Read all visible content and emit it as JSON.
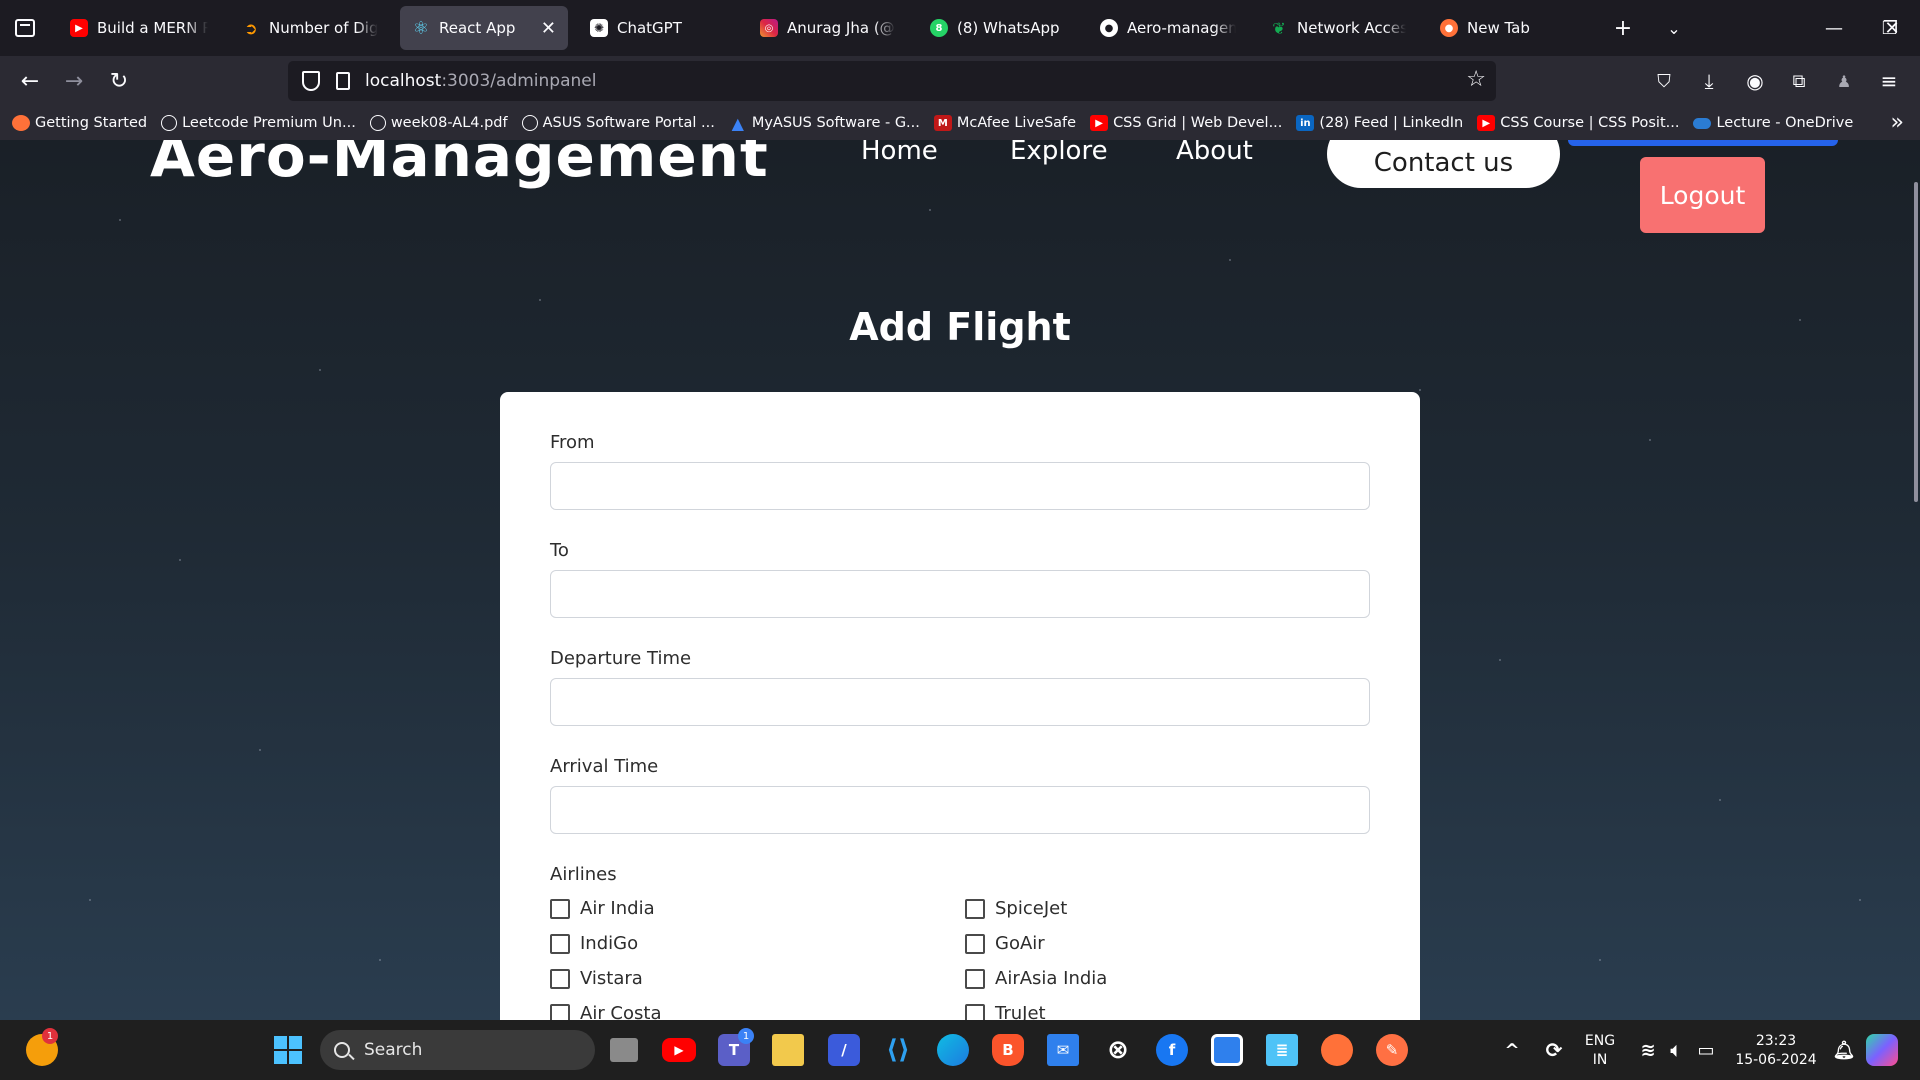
{
  "browser": {
    "tabs": [
      {
        "label": "Build a MERN Rea",
        "favicon": "youtube-icon",
        "color": "#ff0000"
      },
      {
        "label": "Number of Digit",
        "favicon": "amazon-icon",
        "color": "#ff9900"
      },
      {
        "label": "React App",
        "favicon": "react-icon",
        "color": "#61dafb",
        "active": true
      },
      {
        "label": "ChatGPT",
        "favicon": "chatgpt-icon",
        "color": "#ffffff"
      },
      {
        "label": "Anurag Jha (@anu",
        "favicon": "instagram-icon",
        "color": "#e1306c"
      },
      {
        "label": "(8) WhatsApp",
        "favicon": "whatsapp-icon",
        "color": "#25d366"
      },
      {
        "label": "Aero-manageme",
        "favicon": "github-icon",
        "color": "#ffffff"
      },
      {
        "label": "Network Access |",
        "favicon": "mongodb-icon",
        "color": "#13aa52"
      },
      {
        "label": "New Tab",
        "favicon": "firefox-icon",
        "color": "#ff7139"
      }
    ],
    "url_host": "localhost",
    "url_path": ":3003/adminpanel",
    "bookmarks": [
      {
        "label": "Getting Started",
        "icon": "firefox-icon",
        "color": "#ff7139"
      },
      {
        "label": "Leetcode Premium Un...",
        "icon": "globe-icon",
        "color": "#fbfbfe"
      },
      {
        "label": "week08-AL4.pdf",
        "icon": "globe-icon",
        "color": "#fbfbfe"
      },
      {
        "label": "ASUS Software Portal ...",
        "icon": "globe-icon",
        "color": "#fbfbfe"
      },
      {
        "label": "MyASUS Software - G...",
        "icon": "asus-icon",
        "color": "#3b82f6"
      },
      {
        "label": "McAfee LiveSafe",
        "icon": "mcafee-icon",
        "color": "#c01818"
      },
      {
        "label": "CSS Grid | Web Devel...",
        "icon": "youtube-icon",
        "color": "#ff0000"
      },
      {
        "label": "(28) Feed | LinkedIn",
        "icon": "linkedin-icon",
        "color": "#0a66c2"
      },
      {
        "label": "CSS Course | CSS Posit...",
        "icon": "youtube-icon",
        "color": "#ff0000"
      },
      {
        "label": "Lecture - OneDrive",
        "icon": "onedrive-icon",
        "color": "#2b7cd3"
      }
    ]
  },
  "site": {
    "title": "Aero-Management",
    "nav": {
      "home": "Home",
      "explore": "Explore",
      "about": "About",
      "contact": "Contact us"
    },
    "logout": "Logout"
  },
  "form": {
    "heading": "Add Flight",
    "fields": [
      {
        "label": "From",
        "value": ""
      },
      {
        "label": "To",
        "value": ""
      },
      {
        "label": "Departure Time",
        "value": ""
      },
      {
        "label": "Arrival Time",
        "value": ""
      }
    ],
    "airlines_label": "Airlines",
    "airlines": [
      {
        "name": "Air India",
        "checked": false
      },
      {
        "name": "SpiceJet",
        "checked": false
      },
      {
        "name": "IndiGo",
        "checked": false
      },
      {
        "name": "GoAir",
        "checked": false
      },
      {
        "name": "Vistara",
        "checked": false
      },
      {
        "name": "AirAsia India",
        "checked": false
      },
      {
        "name": "Air Costa",
        "checked": false
      },
      {
        "name": "TruJet",
        "checked": false
      }
    ]
  },
  "taskbar": {
    "search_placeholder": "Search",
    "teams_badge": "1",
    "firefox_badge": "1",
    "lang_top": "ENG",
    "lang_bottom": "IN",
    "time": "23:23",
    "date": "15-06-2024"
  },
  "colors": {
    "accent_red": "#f87171",
    "accent_blue": "#2563eb",
    "card_bg": "#ffffff"
  }
}
